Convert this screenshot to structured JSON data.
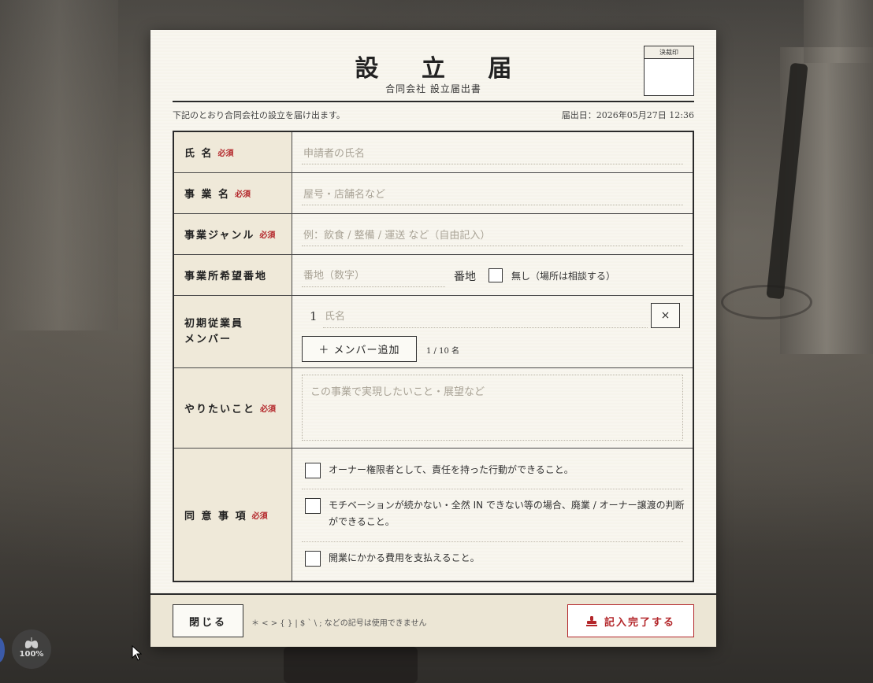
{
  "form": {
    "title": "設 立 届",
    "subtitle": "合同会社 設立届出書",
    "seal_label": "決裁印",
    "intro": "下記のとおり合同会社の設立を届け出ます。",
    "filed_date": "届出日：2026年05月27日 12:36",
    "required_mark": "必須",
    "fields": {
      "name": {
        "label": "氏 名",
        "placeholder": "申請者の氏名",
        "value": ""
      },
      "business_name": {
        "label": "事 業 名",
        "placeholder": "屋号・店舗名など",
        "value": ""
      },
      "genre": {
        "label": "事業ジャンル",
        "placeholder": "例：飲食 / 整備 / 運送 など（自由記入）",
        "value": ""
      },
      "lot": {
        "label": "事業所希望番地",
        "placeholder": "番地（数字）",
        "value": "",
        "suffix": "番地",
        "none_label": "無し（場所は相談する）",
        "none_checked": false
      },
      "members": {
        "label_line1": "初期従業員",
        "label_line2": "メンバー",
        "rows": [
          {
            "index": "1",
            "placeholder": "氏名",
            "value": "",
            "remove_label": "×"
          }
        ],
        "add_label": "＋ メンバー追加",
        "count": "1 / 10 名"
      },
      "goals": {
        "label": "やりたいこと",
        "placeholder": "この事業で実現したいこと・展望など",
        "value": ""
      },
      "agreements": {
        "label": "同 意 事 項",
        "items": [
          {
            "text": "オーナー権限者として、責任を持った行動ができること。",
            "checked": false
          },
          {
            "text": "モチベーションが続かない・全然 IN できない等の場合、廃業 / オーナー譲渡の判断ができること。",
            "checked": false
          },
          {
            "text": "開業にかかる費用を支払えること。",
            "checked": false
          }
        ]
      }
    },
    "footer": {
      "close_label": "閉じる",
      "note": "＊ < > { } | $ ` \\ ; などの記号は使用できません",
      "submit_label": "記入完了する",
      "submit_icon": "stamp-icon",
      "accent_color": "#b3262a"
    }
  },
  "hud": {
    "value": "100%",
    "icon": "lungs-icon"
  }
}
